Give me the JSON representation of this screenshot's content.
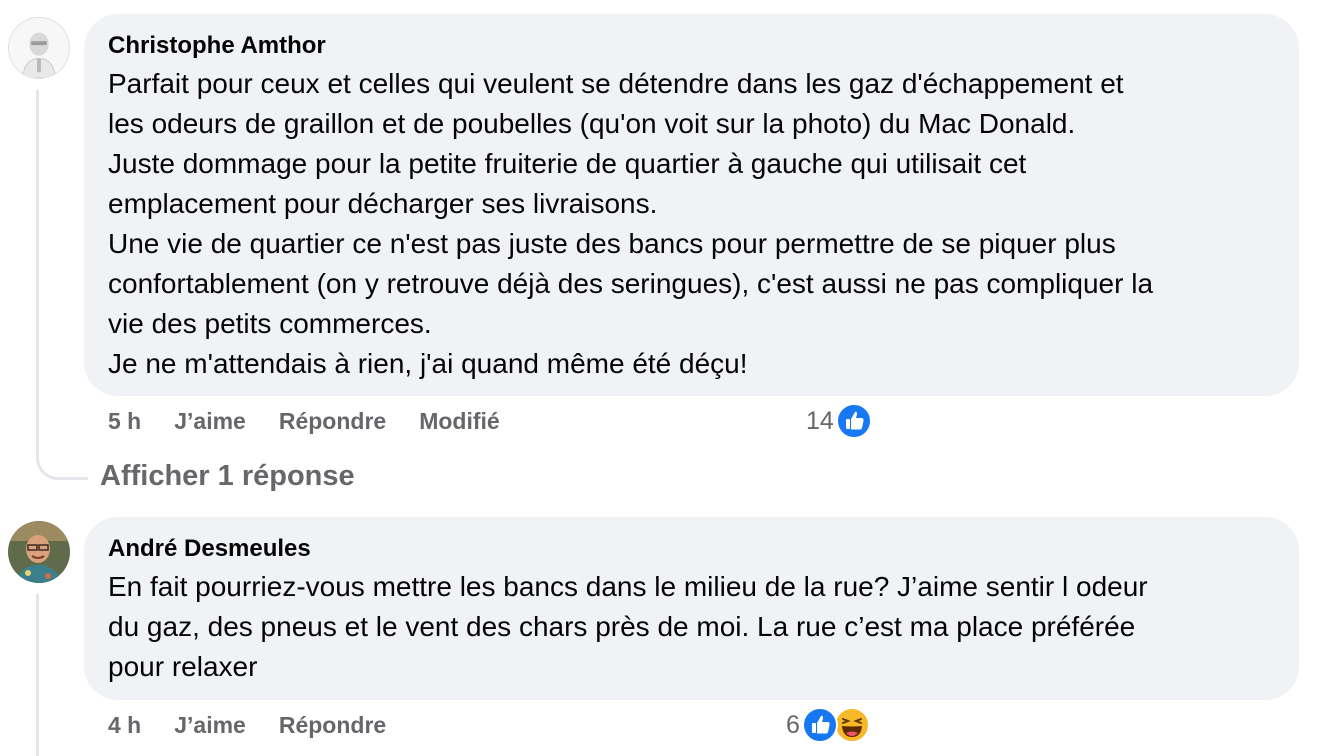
{
  "comments": [
    {
      "author": "Christophe Amthor",
      "lines": [
        "Parfait pour ceux et celles qui veulent se détendre dans les gaz d'échappement et",
        "les odeurs de graillon et de poubelles (qu'on voit sur la photo) du Mac Donald.",
        "Juste dommage pour la petite fruiterie de quartier à gauche qui utilisait cet",
        "emplacement pour décharger ses livraisons.",
        "Une vie de quartier ce n'est pas juste des bancs pour permettre de se piquer plus",
        "confortablement (on y retrouve déjà des seringues), c'est aussi ne pas compliquer la",
        "vie des petits commerces.",
        "Je ne m'attendais à rien, j'ai quand même été déçu!"
      ],
      "time": "5 h",
      "like_label": "J’aime",
      "reply_label": "Répondre",
      "edited_label": "Modifié",
      "reaction_count": "14",
      "reactions": [
        "like-icon"
      ]
    },
    {
      "author": "André Desmeules",
      "lines": [
        "En fait pourriez-vous mettre les bancs dans le milieu de la rue? J’aime sentir l odeur",
        "du gaz, des pneus et le vent des chars près de moi. La rue c’est ma place préférée",
        "pour relaxer"
      ],
      "time": "4 h",
      "like_label": "J’aime",
      "reply_label": "Répondre",
      "reaction_count": "6",
      "reactions": [
        "like-icon",
        "haha-icon"
      ]
    }
  ],
  "show_replies_label": "Afficher 1 réponse",
  "colors": {
    "bubble": "#f0f2f5",
    "meta_text": "#65676b",
    "like_blue": "#1877f2",
    "haha_yellow": "#f7b928"
  }
}
